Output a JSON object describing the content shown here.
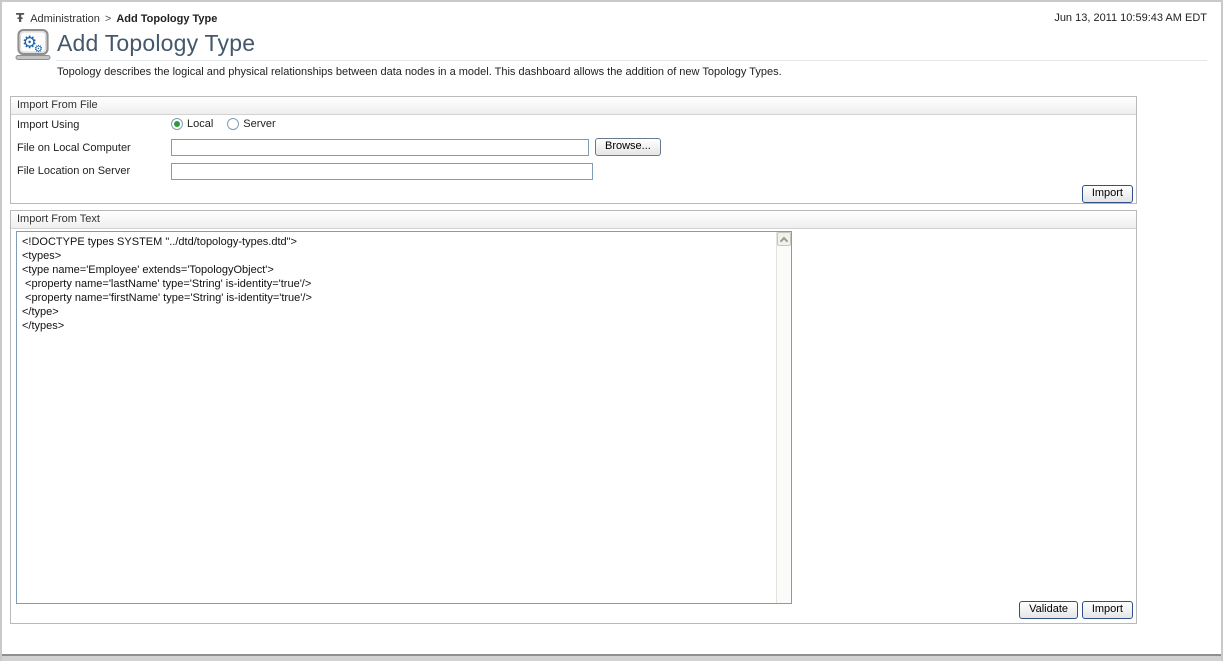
{
  "breadcrumb": {
    "section": "Administration",
    "separator": ">",
    "page": "Add Topology Type"
  },
  "timestamp": "Jun 13, 2011 10:59:43 AM EDT",
  "header": {
    "title": "Add Topology Type",
    "description": "Topology describes the logical and physical relationships between data nodes in a model. This dashboard allows the addition of new Topology Types."
  },
  "file_panel": {
    "title": "Import From File",
    "import_using_label": "Import Using",
    "local_option": "Local",
    "server_option": "Server",
    "local_selected": true,
    "file_on_local_label": "File on Local Computer",
    "file_on_local_value": "",
    "browse_button": "Browse...",
    "file_on_server_label": "File Location on Server",
    "file_on_server_value": "",
    "import_button": "Import"
  },
  "text_panel": {
    "title": "Import From Text",
    "content": "<!DOCTYPE types SYSTEM \"../dtd/topology-types.dtd\">\n<types>\n<type name='Employee' extends='TopologyObject'>\n <property name='lastName' type='String' is-identity='true'/>\n <property name='firstName' type='String' is-identity='true'/>\n</type>\n</types>",
    "validate_button": "Validate",
    "import_button": "Import"
  },
  "icons": {
    "breadcrumb_glyph": "Ŧ",
    "breadcrumb_icon": "dashboard-top-level-icon",
    "title_icon": "topology-gears-monitor-icon",
    "scroll_icon": "chevron-up-icon"
  },
  "colors": {
    "title_text": "#44586c",
    "input_border": "#7f9db9",
    "button_border": "#31518c",
    "radio_selected": "#2f9b38",
    "panel_border": "#b9b9b9"
  }
}
